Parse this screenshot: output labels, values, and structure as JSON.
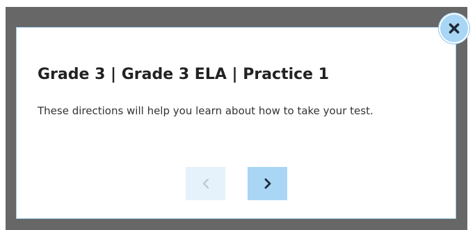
{
  "dialog": {
    "title": "Grade 3 | Grade 3 ELA | Practice 1",
    "message": "These directions will help you learn about how to take your test."
  },
  "icons": {
    "close": "close-icon",
    "previous": "chevron-left-icon",
    "next": "chevron-right-icon"
  },
  "colors": {
    "overlay": "#676767",
    "dialog_border": "#9fcdea",
    "button_active": "#a8d6f4",
    "button_disabled": "#e5f2fb",
    "icon_dark": "#1f2a36"
  }
}
